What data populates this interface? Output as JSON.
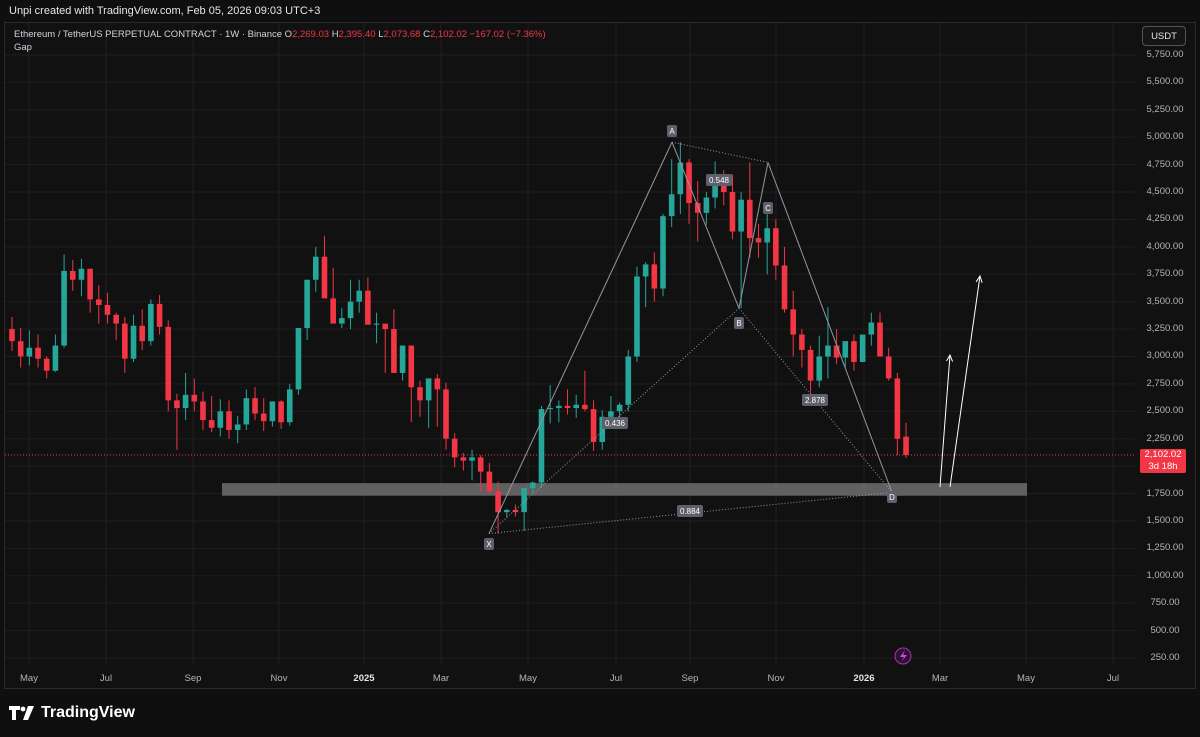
{
  "header": {
    "created_by": "Unpi created with TradingView.com, Feb 05, 2026 09:03 UTC+3"
  },
  "legend": {
    "symbol": "Ethereum / TetherUS PERPETUAL CONTRACT · 1W · Binance",
    "open_key": "O",
    "open": "2,269.03",
    "high_key": "H",
    "high": "2,395.40",
    "low_key": "L",
    "low": "2,073.68",
    "close_key": "C",
    "close": "2,102.02",
    "change": "−167.02 (−7.36%)",
    "indicator": "Gap"
  },
  "currency_button": "USDT",
  "price_scale": [
    "5,750.00",
    "5,500.00",
    "5,250.00",
    "5,000.00",
    "4,750.00",
    "4,500.00",
    "4,250.00",
    "4,000.00",
    "3,750.00",
    "3,500.00",
    "3,250.00",
    "3,000.00",
    "2,750.00",
    "2,500.00",
    "2,250.00",
    "1,750.00",
    "1,500.00",
    "1,250.00",
    "1,000.00",
    "750.00",
    "500.00",
    "250.00"
  ],
  "current_price": {
    "value": "2,102.02",
    "countdown": "3d 18h",
    "color": "#f23645"
  },
  "time_scale": [
    {
      "label": "May",
      "bold": false
    },
    {
      "label": "Jul",
      "bold": false
    },
    {
      "label": "Sep",
      "bold": false
    },
    {
      "label": "Nov",
      "bold": false
    },
    {
      "label": "2025",
      "bold": true
    },
    {
      "label": "Mar",
      "bold": false
    },
    {
      "label": "May",
      "bold": false
    },
    {
      "label": "Jul",
      "bold": false
    },
    {
      "label": "Sep",
      "bold": false
    },
    {
      "label": "Nov",
      "bold": false
    },
    {
      "label": "2026",
      "bold": true
    },
    {
      "label": "Mar",
      "bold": false
    },
    {
      "label": "May",
      "bold": false
    },
    {
      "label": "Jul",
      "bold": false
    }
  ],
  "pattern": {
    "points": [
      {
        "label": "X",
        "price": 1385
      },
      {
        "label": "A",
        "price": 4955
      },
      {
        "label": "B",
        "price": 3440
      },
      {
        "label": "C",
        "price": 4770
      },
      {
        "label": "D",
        "price": 1760
      }
    ],
    "ratios": [
      "0.548",
      "0.436",
      "2.878",
      "0.884"
    ]
  },
  "zone": {
    "from": 1730,
    "to": 1845
  },
  "colors": {
    "up": "#26a69a",
    "down": "#f23645",
    "background": "#111111",
    "grid": "#1e1e1e",
    "pattern": "#9598a1"
  },
  "footer": {
    "brand": "TradingView"
  },
  "chart_data": {
    "type": "candlestick",
    "symbol": "ETHUSDT.P",
    "interval": "1W",
    "ylim": [
      250,
      5750
    ],
    "candles_ohlc": [
      [
        3250,
        3360,
        3050,
        3140
      ],
      [
        3140,
        3260,
        2900,
        3000
      ],
      [
        3000,
        3240,
        2920,
        3080
      ],
      [
        3080,
        3200,
        2900,
        2980
      ],
      [
        2980,
        3000,
        2800,
        2870
      ],
      [
        2870,
        3200,
        2860,
        3100
      ],
      [
        3100,
        3930,
        3080,
        3780
      ],
      [
        3780,
        3880,
        3600,
        3700
      ],
      [
        3700,
        3890,
        3550,
        3800
      ],
      [
        3800,
        3800,
        3400,
        3520
      ],
      [
        3520,
        3650,
        3300,
        3470
      ],
      [
        3470,
        3580,
        3300,
        3380
      ],
      [
        3380,
        3400,
        3150,
        3300
      ],
      [
        3300,
        3360,
        2850,
        2980
      ],
      [
        2980,
        3380,
        2950,
        3280
      ],
      [
        3280,
        3430,
        3060,
        3140
      ],
      [
        3140,
        3520,
        3100,
        3480
      ],
      [
        3480,
        3560,
        3200,
        3270
      ],
      [
        3270,
        3330,
        2500,
        2600
      ],
      [
        2600,
        2660,
        2150,
        2530
      ],
      [
        2530,
        2850,
        2420,
        2650
      ],
      [
        2650,
        2800,
        2500,
        2590
      ],
      [
        2590,
        2680,
        2330,
        2420
      ],
      [
        2420,
        2640,
        2310,
        2350
      ],
      [
        2350,
        2610,
        2270,
        2500
      ],
      [
        2500,
        2600,
        2250,
        2330
      ],
      [
        2330,
        2460,
        2210,
        2380
      ],
      [
        2380,
        2700,
        2330,
        2620
      ],
      [
        2620,
        2720,
        2420,
        2480
      ],
      [
        2480,
        2620,
        2320,
        2410
      ],
      [
        2410,
        2590,
        2360,
        2590
      ],
      [
        2590,
        2600,
        2340,
        2400
      ],
      [
        2400,
        2750,
        2370,
        2700
      ],
      [
        2700,
        3120,
        2650,
        3260
      ],
      [
        3260,
        3500,
        3150,
        3700
      ],
      [
        3700,
        4000,
        3590,
        3910
      ],
      [
        3910,
        4100,
        3600,
        3530
      ],
      [
        3530,
        3810,
        3380,
        3300
      ],
      [
        3300,
        3440,
        3260,
        3350
      ],
      [
        3350,
        3700,
        3250,
        3500
      ],
      [
        3500,
        3700,
        3400,
        3600
      ],
      [
        3600,
        3720,
        3350,
        3290
      ],
      [
        3290,
        3400,
        3120,
        3300
      ],
      [
        3300,
        3300,
        2850,
        3250
      ],
      [
        3250,
        3430,
        3200,
        2850
      ],
      [
        2850,
        3100,
        2780,
        3100
      ],
      [
        3100,
        3090,
        2400,
        2720
      ],
      [
        2720,
        2780,
        2450,
        2600
      ],
      [
        2600,
        2750,
        2350,
        2800
      ],
      [
        2800,
        2840,
        2360,
        2700
      ],
      [
        2700,
        2760,
        2150,
        2250
      ],
      [
        2250,
        2300,
        1990,
        2080
      ],
      [
        2080,
        2120,
        1960,
        2050
      ],
      [
        2050,
        2150,
        1870,
        2080
      ],
      [
        2080,
        2100,
        1770,
        1950
      ],
      [
        1950,
        2030,
        1750,
        1770
      ],
      [
        1770,
        1860,
        1385,
        1580
      ],
      [
        1580,
        1610,
        1530,
        1600
      ],
      [
        1600,
        1650,
        1540,
        1580
      ],
      [
        1580,
        1750,
        1410,
        1800
      ],
      [
        1800,
        1860,
        1750,
        1850
      ],
      [
        1850,
        2550,
        1800,
        2520
      ],
      [
        2520,
        2740,
        2390,
        2530
      ],
      [
        2530,
        2600,
        2400,
        2550
      ],
      [
        2550,
        2700,
        2470,
        2530
      ],
      [
        2530,
        2650,
        2440,
        2560
      ],
      [
        2560,
        2870,
        2500,
        2520
      ],
      [
        2520,
        2600,
        2140,
        2220
      ],
      [
        2220,
        2510,
        2150,
        2450
      ],
      [
        2450,
        2640,
        2440,
        2500
      ],
      [
        2500,
        2580,
        2430,
        2560
      ],
      [
        2560,
        3060,
        2500,
        3000
      ],
      [
        3000,
        3820,
        2950,
        3730
      ],
      [
        3730,
        3860,
        3450,
        3840
      ],
      [
        3840,
        3950,
        3500,
        3620
      ],
      [
        3620,
        4300,
        3550,
        4280
      ],
      [
        4280,
        4800,
        4180,
        4480
      ],
      [
        4480,
        4955,
        4300,
        4770
      ],
      [
        4770,
        4800,
        4210,
        4400
      ],
      [
        4400,
        4600,
        4050,
        4310
      ],
      [
        4310,
        4500,
        4200,
        4450
      ],
      [
        4450,
        4780,
        4350,
        4610
      ],
      [
        4610,
        4700,
        4380,
        4500
      ],
      [
        4500,
        4660,
        4070,
        4140
      ],
      [
        4140,
        4500,
        3440,
        4430
      ],
      [
        4430,
        4770,
        3900,
        4080
      ],
      [
        4080,
        4210,
        3900,
        4040
      ],
      [
        4040,
        4300,
        3750,
        4170
      ],
      [
        4170,
        4250,
        3700,
        3830
      ],
      [
        3830,
        4000,
        3400,
        3430
      ],
      [
        3430,
        3600,
        3000,
        3200
      ],
      [
        3200,
        3250,
        2900,
        3060
      ],
      [
        3060,
        3100,
        2620,
        2780
      ],
      [
        2780,
        3190,
        2720,
        3000
      ],
      [
        3000,
        3450,
        2800,
        3100
      ],
      [
        3100,
        3250,
        2930,
        2990
      ],
      [
        2990,
        3100,
        2900,
        3140
      ],
      [
        3140,
        3200,
        2870,
        2950
      ],
      [
        2950,
        3120,
        2950,
        3200
      ],
      [
        3200,
        3400,
        3100,
        3310
      ],
      [
        3310,
        3400,
        3050,
        3000
      ],
      [
        3000,
        3080,
        2780,
        2800
      ],
      [
        2800,
        2850,
        2100,
        2250
      ],
      [
        2269,
        2395,
        2074,
        2102
      ]
    ]
  }
}
